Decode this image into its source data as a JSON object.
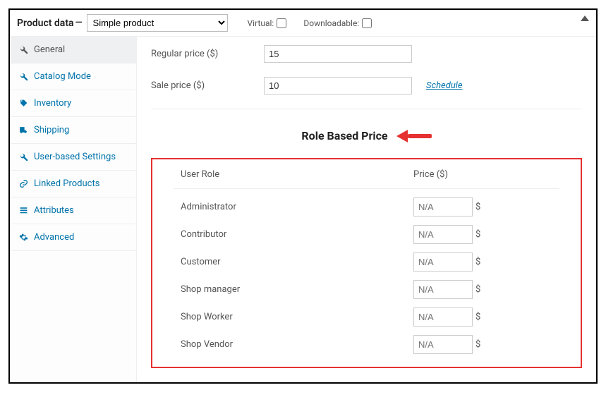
{
  "header": {
    "title": "Product data",
    "dash": "—",
    "product_type": "Simple product",
    "virtual_label": "Virtual:",
    "downloadable_label": "Downloadable:"
  },
  "sidebar": {
    "items": [
      {
        "label": "General",
        "icon": "wrench",
        "active": true
      },
      {
        "label": "Catalog Mode",
        "icon": "wrench",
        "active": false
      },
      {
        "label": "Inventory",
        "icon": "tag",
        "active": false
      },
      {
        "label": "Shipping",
        "icon": "truck",
        "active": false
      },
      {
        "label": "User-based Settings",
        "icon": "wrench",
        "active": false
      },
      {
        "label": "Linked Products",
        "icon": "link",
        "active": false
      },
      {
        "label": "Attributes",
        "icon": "list",
        "active": false
      },
      {
        "label": "Advanced",
        "icon": "gear",
        "active": false
      }
    ]
  },
  "pricing": {
    "regular_label": "Regular price ($)",
    "regular_value": "15",
    "sale_label": "Sale price ($)",
    "sale_value": "10",
    "schedule_label": "Schedule"
  },
  "role_price": {
    "title": "Role Based Price",
    "col_role": "User Role",
    "col_price": "Price ($)",
    "placeholder": "N/A",
    "currency": "$",
    "rows": [
      {
        "role": "Administrator"
      },
      {
        "role": "Contributor"
      },
      {
        "role": "Customer"
      },
      {
        "role": "Shop manager"
      },
      {
        "role": "Shop Worker"
      },
      {
        "role": "Shop Vendor"
      }
    ]
  }
}
